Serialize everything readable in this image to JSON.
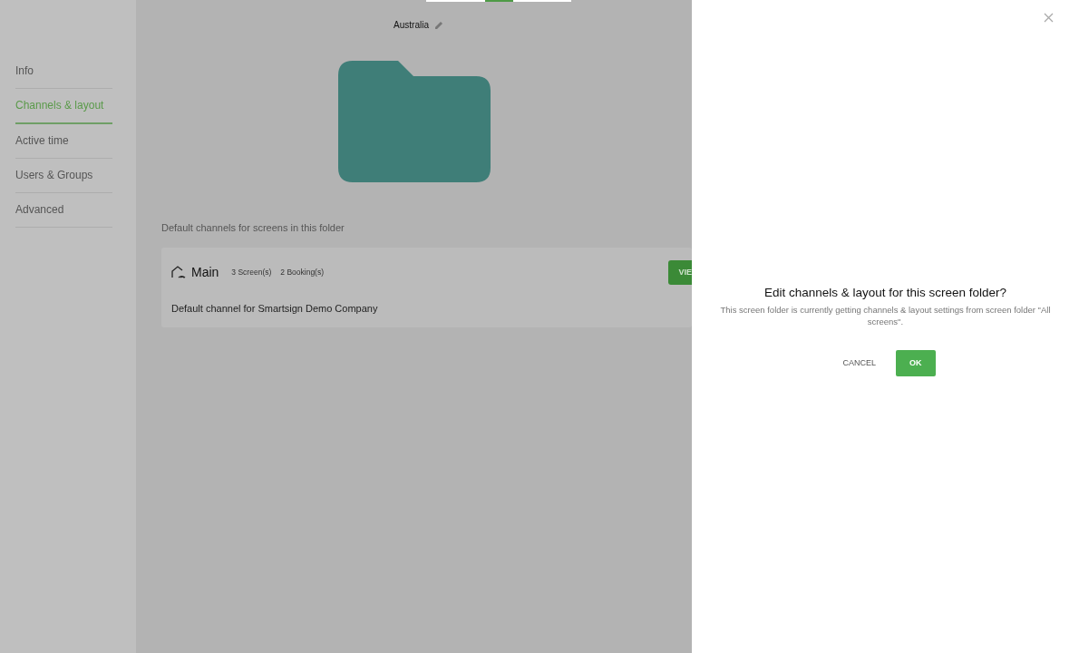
{
  "folder": {
    "name": "Australia"
  },
  "sidebar": {
    "items": [
      {
        "label": "Info",
        "selected": false
      },
      {
        "label": "Channels & layout",
        "selected": true
      },
      {
        "label": "Active time",
        "selected": false
      },
      {
        "label": "Users & Groups",
        "selected": false
      },
      {
        "label": "Advanced",
        "selected": false
      }
    ]
  },
  "channels_section": {
    "heading": "Default channels for screens in this folder",
    "channels": [
      {
        "name": "Main",
        "screens": "3 Screen(s)",
        "bookings": "2 Booking(s)",
        "description": "Default channel for Smartsign Demo Company",
        "button": "VIE"
      }
    ]
  },
  "dialog": {
    "title": "Edit channels & layout for this screen folder?",
    "message": "This screen folder is currently getting channels & layout settings from screen folder \"All screens\".",
    "buttons": [
      {
        "kind": "text",
        "label": "CANCEL"
      },
      {
        "kind": "primary",
        "label": "OK"
      }
    ]
  }
}
